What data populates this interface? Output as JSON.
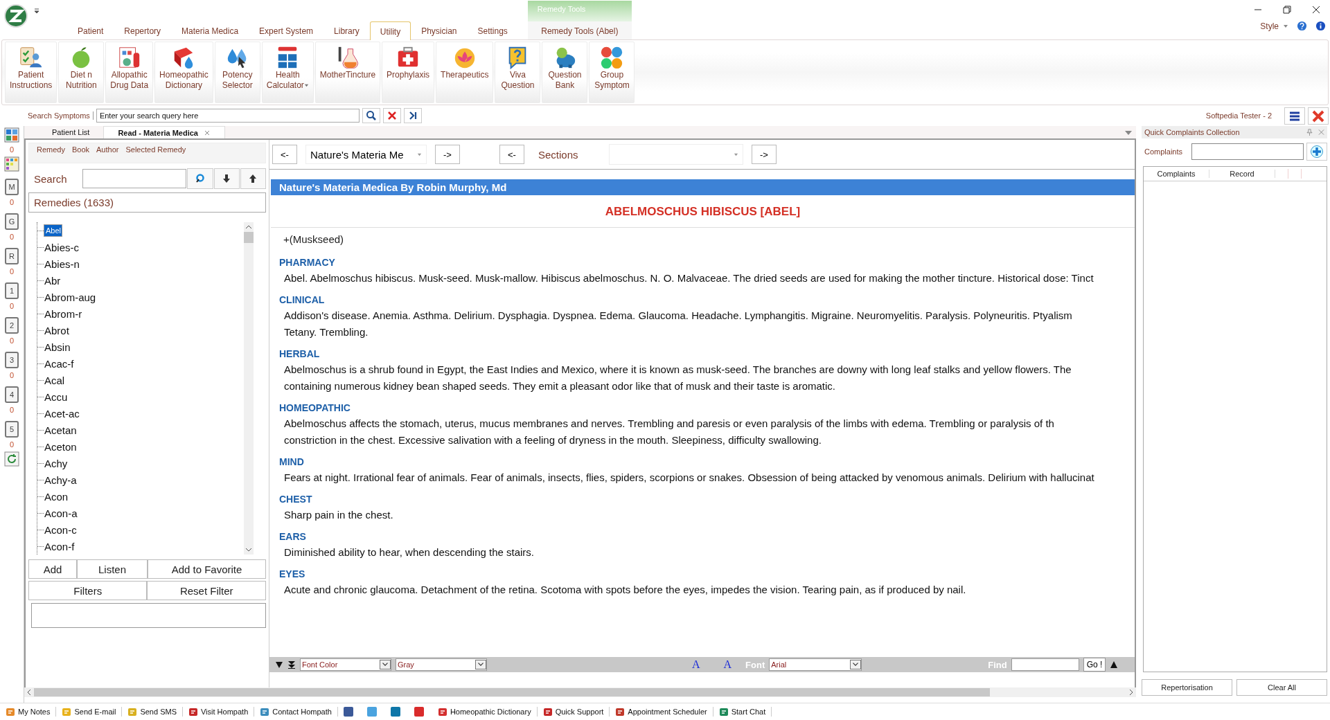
{
  "menu_tabs": [
    {
      "label": "Patient",
      "selected": false
    },
    {
      "label": "Repertory",
      "selected": false
    },
    {
      "label": "Materia Medica",
      "selected": false
    },
    {
      "label": "Expert System",
      "selected": false
    },
    {
      "label": "Library",
      "selected": false
    },
    {
      "label": "Utility",
      "selected": true
    },
    {
      "label": "Physician",
      "selected": false
    },
    {
      "label": "Settings",
      "selected": false
    },
    {
      "label": "Remedy Tools (Abel)",
      "selected": false,
      "kind": "contextual"
    }
  ],
  "context_group": "Remedy Tools",
  "style_label": "Style",
  "ribbon": [
    {
      "lines": [
        "Patient",
        "Instructions"
      ]
    },
    {
      "lines": [
        "Diet n",
        "Nutrition"
      ]
    },
    {
      "lines": [
        "Allopathic",
        "Drug Data"
      ]
    },
    {
      "lines": [
        "Homeopathic",
        "Dictionary"
      ]
    },
    {
      "lines": [
        "Potency",
        "Selector"
      ]
    },
    {
      "lines": [
        "Health",
        "Calculator"
      ],
      "kind": "dropdown"
    },
    {
      "lines": [
        "MotherTincture"
      ]
    },
    {
      "lines": [
        "Prophylaxis"
      ]
    },
    {
      "lines": [
        "Therapeutics"
      ]
    },
    {
      "lines": [
        "Viva",
        "Question"
      ]
    },
    {
      "lines": [
        "Question",
        "Bank"
      ]
    },
    {
      "lines": [
        "Group",
        "Symptom"
      ]
    }
  ],
  "search_bar": {
    "label": "Search Symptoms",
    "placeholder": "Enter your search query here",
    "user": "Softpedia Tester - 2"
  },
  "rail": [
    {
      "kind": "board",
      "count": "0"
    },
    {
      "kind": "palette"
    },
    {
      "kind": "letter",
      "label": "M",
      "count": "0"
    },
    {
      "kind": "letter",
      "label": "G",
      "count": "0"
    },
    {
      "kind": "letter",
      "label": "R",
      "count": "0"
    },
    {
      "kind": "letter",
      "label": "1",
      "count": "0"
    },
    {
      "kind": "letter",
      "label": "2",
      "count": "0"
    },
    {
      "kind": "letter",
      "label": "3",
      "count": "0"
    },
    {
      "kind": "letter",
      "label": "4",
      "count": "0"
    },
    {
      "kind": "letter",
      "label": "5",
      "count": "0"
    },
    {
      "kind": "refresh"
    }
  ],
  "doc_tabs": [
    {
      "label": "Patient List",
      "selected": false
    },
    {
      "label": "Read - Materia Medica",
      "selected": true,
      "closable": true
    }
  ],
  "left_panel": {
    "tabs": [
      "Remedy",
      "Book",
      "Author",
      "Selected Remedy"
    ],
    "search_label": "Search",
    "list_title": "Remedies (1633)",
    "remedies": [
      {
        "name": "Abel",
        "selected": true
      },
      {
        "name": "Abies-c",
        "selected": false
      },
      {
        "name": "Abies-n",
        "selected": false
      },
      {
        "name": "Abr",
        "selected": false
      },
      {
        "name": "Abrom-aug",
        "selected": false
      },
      {
        "name": "Abrom-r",
        "selected": false
      },
      {
        "name": "Abrot",
        "selected": false
      },
      {
        "name": "Absin",
        "selected": false
      },
      {
        "name": "Acac-f",
        "selected": false
      },
      {
        "name": "Acal",
        "selected": false
      },
      {
        "name": "Accu",
        "selected": false
      },
      {
        "name": "Acet-ac",
        "selected": false
      },
      {
        "name": "Acetan",
        "selected": false
      },
      {
        "name": "Aceton",
        "selected": false
      },
      {
        "name": "Achy",
        "selected": false
      },
      {
        "name": "Achy-a",
        "selected": false
      },
      {
        "name": "Acon",
        "selected": false
      },
      {
        "name": "Acon-a",
        "selected": false
      },
      {
        "name": "Acon-c",
        "selected": false
      },
      {
        "name": "Acon-f",
        "selected": false
      }
    ],
    "buttons_row1": [
      "Add",
      "Listen",
      "Add to Favorite"
    ],
    "buttons_row2": [
      "Filters",
      "Reset Filter"
    ]
  },
  "reader": {
    "prev": "<-",
    "next": "->",
    "book": "Nature's Materia Me",
    "sections_label": "Sections",
    "header": "Nature's Materia Medica By Robin Murphy, Md",
    "title": "ABELMOSCHUS HIBISCUS [ABEL]",
    "subtitle": "+(Muskseed)",
    "sections": [
      {
        "heading": "PHARMACY",
        "lines": [
          "Abel. Abelmoschus hibiscus. Musk-seed. Musk-mallow. Hibiscus abelmoschus. N. O. Malvaceae. The dried seeds are used for making the mother tincture. Historical dose: Tinct"
        ]
      },
      {
        "heading": "CLINICAL",
        "lines": [
          "Addison's disease. Anemia. Asthma. Delirium. Dysphagia. Dyspnea. Edema. Glaucoma. Headache. Lymphangitis. Migraine. Neuromyelitis. Paralysis. Polyneuritis. Ptyalism",
          "Tetany. Trembling."
        ]
      },
      {
        "heading": "HERBAL",
        "lines": [
          "Abelmoschus is a shrub found in Egypt, the East Indies and Mexico, where it is known as musk-seed. The branches are downy with long leaf stalks and yellow flowers. The",
          "containing numerous kidney bean shaped seeds. They emit a pleasant odor like that of musk and their taste is aromatic."
        ]
      },
      {
        "heading": "HOMEOPATHIC",
        "lines": [
          "Abelmoschus affects the stomach, uterus, mucus membranes and nerves. Trembling and paresis or even paralysis of the limbs with edema. Trembling or paralysis of th",
          "constriction in the chest. Excessive salivation with a feeling of dryness in the mouth. Sleepiness, difficulty swallowing."
        ]
      },
      {
        "heading": "MIND",
        "lines": [
          "Fears at night. Irrational fear of animals. Fear of animals, insects, flies, spiders, scorpions or snakes. Obsession of being attacked by venomous animals. Delirium with hallucinat"
        ]
      },
      {
        "heading": "CHEST",
        "lines": [
          "Sharp pain in the chest."
        ]
      },
      {
        "heading": "EARS",
        "lines": [
          "Diminished ability to hear, when descending the stairs."
        ]
      },
      {
        "heading": "EYES",
        "lines": [
          "Acute and chronic glaucoma. Detachment of the retina. Scotoma with spots before the eyes, impedes the vision. Tearing pain, as if produced by nail."
        ]
      }
    ],
    "toolbar": {
      "font_color": "Font Color",
      "color_value": "Gray",
      "size_glyphs": [
        "A",
        "A"
      ],
      "font_label": "Font",
      "font_value": "Arial",
      "find_label": "Find",
      "go": "Go !"
    }
  },
  "complaints_panel": {
    "title": "Quick Complaints Collection",
    "field_label": "Complaints",
    "columns": [
      "Complaints",
      "Record"
    ],
    "buttons": [
      "Repertorisation",
      "Clear All"
    ]
  },
  "status_bar": [
    {
      "kind": "link",
      "label": "My Notes"
    },
    {
      "kind": "link",
      "label": "Send E-mail"
    },
    {
      "kind": "link",
      "label": "Send SMS"
    },
    {
      "kind": "link",
      "label": "Visit Hompath"
    },
    {
      "kind": "link",
      "label": "Contact Hompath"
    },
    {
      "kind": "social",
      "color": "#3b5998"
    },
    {
      "kind": "social",
      "color": "#4aa3df"
    },
    {
      "kind": "social",
      "color": "#0e76a8"
    },
    {
      "kind": "social",
      "color": "#d92b2b"
    },
    {
      "kind": "link",
      "label": "Homeopathic Dictionary"
    },
    {
      "kind": "link",
      "label": "Quick Support"
    },
    {
      "kind": "link",
      "label": "Appointment Scheduler"
    },
    {
      "kind": "link",
      "label": "Start Chat"
    }
  ]
}
